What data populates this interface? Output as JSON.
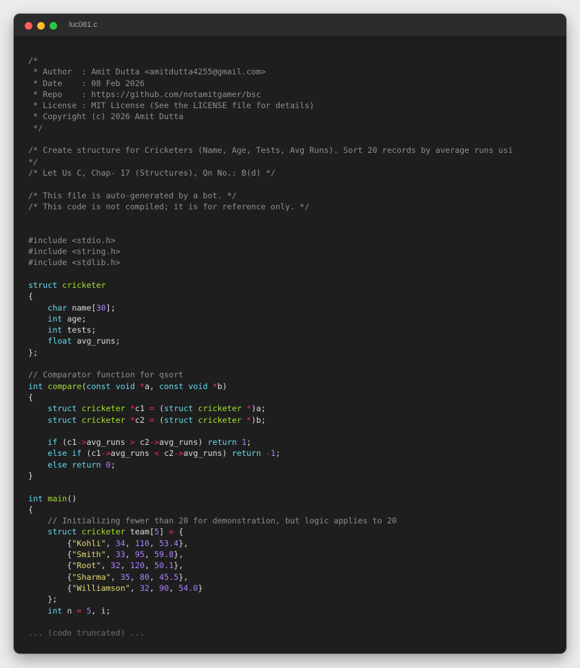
{
  "window": {
    "title": "luc081.c"
  },
  "colors": {
    "comment": "#8f908a",
    "keyword": "#66d9ef",
    "type": "#a6e22e",
    "number": "#ae81ff",
    "string": "#e6db74",
    "operator": "#f92672",
    "plain": "#dcdcdc",
    "background": "#1e1e1e"
  },
  "code_lines": [
    [
      [
        "c",
        "/*"
      ]
    ],
    [
      [
        "c",
        " * Author  : Amit Dutta <amitdutta4255@gmail.com>"
      ]
    ],
    [
      [
        "c",
        " * Date    : 08 Feb 2026"
      ]
    ],
    [
      [
        "c",
        " * Repo    : https://github.com/notamitgamer/bsc"
      ]
    ],
    [
      [
        "c",
        " * License : MIT License (See the LICENSE file for details)"
      ]
    ],
    [
      [
        "c",
        " * Copyright (c) 2026 Amit Dutta"
      ]
    ],
    [
      [
        "c",
        " */"
      ]
    ],
    [],
    [
      [
        "c",
        "/* Create structure for Cricketers (Name, Age, Tests, Avg Runs). Sort 20 records by average runs usi"
      ]
    ],
    [
      [
        "c",
        "*/"
      ]
    ],
    [
      [
        "c",
        "/* Let Us C, Chap- 17 (Structures), Qn No.: B(d) */"
      ]
    ],
    [],
    [
      [
        "c",
        "/* This file is auto-generated by a bot. */"
      ]
    ],
    [
      [
        "c",
        "/* This code is not compiled; it is for reference only. */"
      ]
    ],
    [],
    [],
    [
      [
        "c",
        "#include <stdio.h>"
      ]
    ],
    [
      [
        "c",
        "#include <string.h>"
      ]
    ],
    [
      [
        "c",
        "#include <stdlib.h>"
      ]
    ],
    [],
    [
      [
        "k",
        "struct"
      ],
      [
        "p",
        " "
      ],
      [
        "t",
        "cricketer"
      ]
    ],
    [
      [
        "p",
        "{"
      ]
    ],
    [
      [
        "p",
        "    "
      ],
      [
        "k",
        "char"
      ],
      [
        "p",
        " name["
      ],
      [
        "n",
        "30"
      ],
      [
        "p",
        "];"
      ]
    ],
    [
      [
        "p",
        "    "
      ],
      [
        "k",
        "int"
      ],
      [
        "p",
        " age;"
      ]
    ],
    [
      [
        "p",
        "    "
      ],
      [
        "k",
        "int"
      ],
      [
        "p",
        " tests;"
      ]
    ],
    [
      [
        "p",
        "    "
      ],
      [
        "k",
        "float"
      ],
      [
        "p",
        " avg_runs;"
      ]
    ],
    [
      [
        "p",
        "};"
      ]
    ],
    [],
    [
      [
        "c",
        "// Comparator function for qsort"
      ]
    ],
    [
      [
        "k",
        "int"
      ],
      [
        "p",
        " "
      ],
      [
        "f",
        "compare"
      ],
      [
        "p",
        "("
      ],
      [
        "k",
        "const"
      ],
      [
        "p",
        " "
      ],
      [
        "k",
        "void"
      ],
      [
        "p",
        " "
      ],
      [
        "o",
        "*"
      ],
      [
        "p",
        "a, "
      ],
      [
        "k",
        "const"
      ],
      [
        "p",
        " "
      ],
      [
        "k",
        "void"
      ],
      [
        "p",
        " "
      ],
      [
        "o",
        "*"
      ],
      [
        "p",
        "b)"
      ]
    ],
    [
      [
        "p",
        "{"
      ]
    ],
    [
      [
        "p",
        "    "
      ],
      [
        "k",
        "struct"
      ],
      [
        "p",
        " "
      ],
      [
        "t",
        "cricketer"
      ],
      [
        "p",
        " "
      ],
      [
        "o",
        "*"
      ],
      [
        "p",
        "c1 "
      ],
      [
        "o",
        "="
      ],
      [
        "p",
        " ("
      ],
      [
        "k",
        "struct"
      ],
      [
        "p",
        " "
      ],
      [
        "t",
        "cricketer"
      ],
      [
        "p",
        " "
      ],
      [
        "o",
        "*"
      ],
      [
        "p",
        ")a;"
      ]
    ],
    [
      [
        "p",
        "    "
      ],
      [
        "k",
        "struct"
      ],
      [
        "p",
        " "
      ],
      [
        "t",
        "cricketer"
      ],
      [
        "p",
        " "
      ],
      [
        "o",
        "*"
      ],
      [
        "p",
        "c2 "
      ],
      [
        "o",
        "="
      ],
      [
        "p",
        " ("
      ],
      [
        "k",
        "struct"
      ],
      [
        "p",
        " "
      ],
      [
        "t",
        "cricketer"
      ],
      [
        "p",
        " "
      ],
      [
        "o",
        "*"
      ],
      [
        "p",
        ")b;"
      ]
    ],
    [],
    [
      [
        "p",
        "    "
      ],
      [
        "k",
        "if"
      ],
      [
        "p",
        " (c1"
      ],
      [
        "o",
        "->"
      ],
      [
        "p",
        "avg_runs "
      ],
      [
        "o",
        ">"
      ],
      [
        "p",
        " c2"
      ],
      [
        "o",
        "->"
      ],
      [
        "p",
        "avg_runs) "
      ],
      [
        "k",
        "return"
      ],
      [
        "p",
        " "
      ],
      [
        "n",
        "1"
      ],
      [
        "p",
        ";"
      ]
    ],
    [
      [
        "p",
        "    "
      ],
      [
        "k",
        "else"
      ],
      [
        "p",
        " "
      ],
      [
        "k",
        "if"
      ],
      [
        "p",
        " (c1"
      ],
      [
        "o",
        "->"
      ],
      [
        "p",
        "avg_runs "
      ],
      [
        "o",
        "<"
      ],
      [
        "p",
        " c2"
      ],
      [
        "o",
        "->"
      ],
      [
        "p",
        "avg_runs) "
      ],
      [
        "k",
        "return"
      ],
      [
        "p",
        " "
      ],
      [
        "o",
        "-"
      ],
      [
        "n",
        "1"
      ],
      [
        "p",
        ";"
      ]
    ],
    [
      [
        "p",
        "    "
      ],
      [
        "k",
        "else"
      ],
      [
        "p",
        " "
      ],
      [
        "k",
        "return"
      ],
      [
        "p",
        " "
      ],
      [
        "n",
        "0"
      ],
      [
        "p",
        ";"
      ]
    ],
    [
      [
        "p",
        "}"
      ]
    ],
    [],
    [
      [
        "k",
        "int"
      ],
      [
        "p",
        " "
      ],
      [
        "f",
        "main"
      ],
      [
        "p",
        "()"
      ]
    ],
    [
      [
        "p",
        "{"
      ]
    ],
    [
      [
        "p",
        "    "
      ],
      [
        "c",
        "// Initializing fewer than 20 for demonstration, but logic applies to 20"
      ]
    ],
    [
      [
        "p",
        "    "
      ],
      [
        "k",
        "struct"
      ],
      [
        "p",
        " "
      ],
      [
        "t",
        "cricketer"
      ],
      [
        "p",
        " team["
      ],
      [
        "n",
        "5"
      ],
      [
        "p",
        "] "
      ],
      [
        "o",
        "="
      ],
      [
        "p",
        " {"
      ]
    ],
    [
      [
        "p",
        "        {"
      ],
      [
        "s",
        "\"Kohli\""
      ],
      [
        "p",
        ", "
      ],
      [
        "n",
        "34"
      ],
      [
        "p",
        ", "
      ],
      [
        "n",
        "110"
      ],
      [
        "p",
        ", "
      ],
      [
        "n",
        "53.4"
      ],
      [
        "p",
        "},"
      ]
    ],
    [
      [
        "p",
        "        {"
      ],
      [
        "s",
        "\"Smith\""
      ],
      [
        "p",
        ", "
      ],
      [
        "n",
        "33"
      ],
      [
        "p",
        ", "
      ],
      [
        "n",
        "95"
      ],
      [
        "p",
        ", "
      ],
      [
        "n",
        "59.8"
      ],
      [
        "p",
        "},"
      ]
    ],
    [
      [
        "p",
        "        {"
      ],
      [
        "s",
        "\"Root\""
      ],
      [
        "p",
        ", "
      ],
      [
        "n",
        "32"
      ],
      [
        "p",
        ", "
      ],
      [
        "n",
        "120"
      ],
      [
        "p",
        ", "
      ],
      [
        "n",
        "50.1"
      ],
      [
        "p",
        "},"
      ]
    ],
    [
      [
        "p",
        "        {"
      ],
      [
        "s",
        "\"Sharma\""
      ],
      [
        "p",
        ", "
      ],
      [
        "n",
        "35"
      ],
      [
        "p",
        ", "
      ],
      [
        "n",
        "80"
      ],
      [
        "p",
        ", "
      ],
      [
        "n",
        "45.5"
      ],
      [
        "p",
        "},"
      ]
    ],
    [
      [
        "p",
        "        {"
      ],
      [
        "s",
        "\"Williamson\""
      ],
      [
        "p",
        ", "
      ],
      [
        "n",
        "32"
      ],
      [
        "p",
        ", "
      ],
      [
        "n",
        "90"
      ],
      [
        "p",
        ", "
      ],
      [
        "n",
        "54.0"
      ],
      [
        "p",
        "}"
      ]
    ],
    [
      [
        "p",
        "    };"
      ]
    ],
    [
      [
        "p",
        "    "
      ],
      [
        "k",
        "int"
      ],
      [
        "p",
        " n "
      ],
      [
        "o",
        "="
      ],
      [
        "p",
        " "
      ],
      [
        "n",
        "5"
      ],
      [
        "p",
        ", i;"
      ]
    ],
    [],
    [
      [
        "x",
        "... (code truncated) ..."
      ]
    ]
  ]
}
